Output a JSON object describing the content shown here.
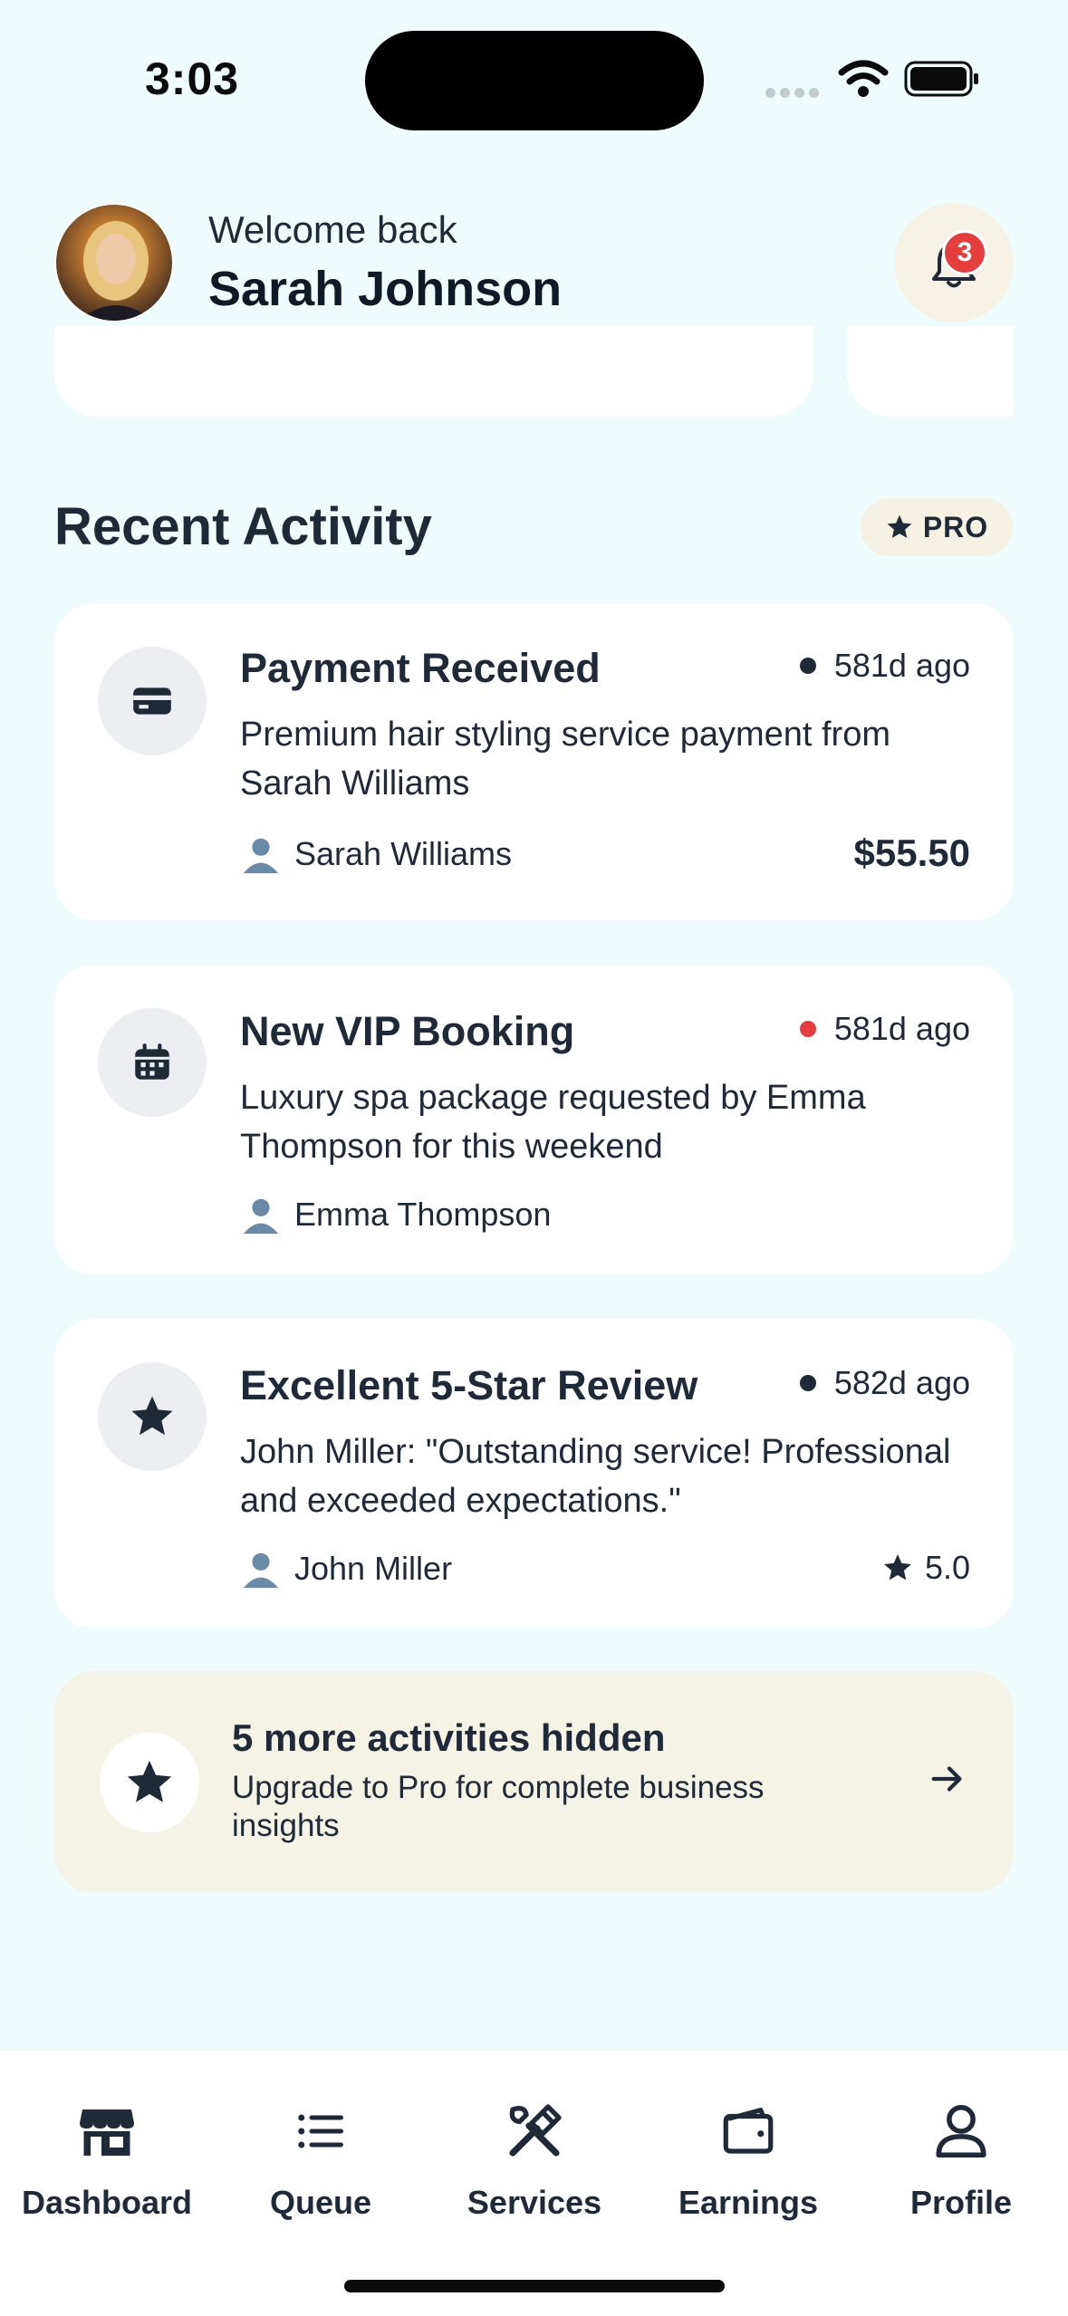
{
  "status_bar": {
    "time": "3:03"
  },
  "header": {
    "welcome": "Welcome back",
    "name": "Sarah Johnson",
    "notification_count": "3"
  },
  "section": {
    "title": "Recent Activity",
    "badge": "PRO"
  },
  "activities": [
    {
      "icon": "credit-card-icon",
      "title": "Payment Received",
      "time": "581d ago",
      "dot_color": "#1f2937",
      "description": "Premium hair styling service payment from Sarah Williams",
      "person": "Sarah Williams",
      "amount": "$55.50"
    },
    {
      "icon": "calendar-icon",
      "title": "New VIP Booking",
      "time": "581d ago",
      "dot_color": "#e53e3e",
      "description": "Luxury spa package requested by Emma Thompson for this weekend",
      "person": "Emma Thompson"
    },
    {
      "icon": "star-icon",
      "title": "Excellent 5-Star Review",
      "time": "582d ago",
      "dot_color": "#1f2937",
      "description": "John Miller: \"Outstanding service! Professional and exceeded expectations.\"",
      "person": "John Miller",
      "rating": "5.0"
    }
  ],
  "upsell": {
    "title": "5 more activities hidden",
    "subtitle": "Upgrade to Pro for complete business insights"
  },
  "nav": {
    "items": [
      {
        "label": "Dashboard",
        "icon": "storefront-icon"
      },
      {
        "label": "Queue",
        "icon": "list-icon"
      },
      {
        "label": "Services",
        "icon": "tools-icon"
      },
      {
        "label": "Earnings",
        "icon": "wallet-icon"
      },
      {
        "label": "Profile",
        "icon": "person-icon"
      }
    ]
  },
  "colors": {
    "background": "#effcfd",
    "text": "#1f2937",
    "badge_red": "#e53e3e",
    "pro_bg": "#f5f1e3"
  }
}
